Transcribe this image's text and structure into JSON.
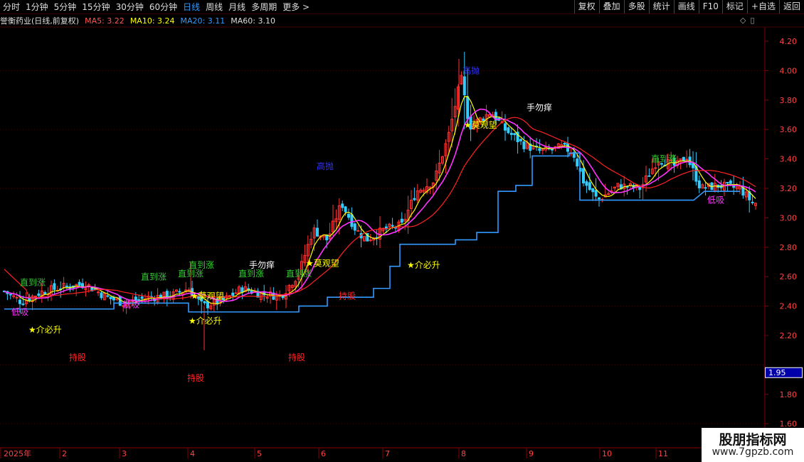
{
  "toolbar": {
    "periods": [
      "分时",
      "1分钟",
      "5分钟",
      "15分钟",
      "30分钟",
      "60分钟",
      "日线",
      "周线",
      "月线",
      "多周期",
      "更多 >"
    ],
    "active_period": "日线",
    "actions": [
      "复权",
      "叠加",
      "多股",
      "统计",
      "画线",
      "F10",
      "标记",
      "+自选",
      "返回"
    ]
  },
  "info": {
    "stock": "誉衡药业(日线,前复权)",
    "ma5": "MA5: 3.22",
    "ma10": "MA10: 3.24",
    "ma20": "MA20: 3.11",
    "ma60": "MA60: 3.10"
  },
  "controls": {
    "diamond": "◇",
    "panel": "▯"
  },
  "price_axis": {
    "ticks": [
      "4.20",
      "4.00",
      "3.80",
      "3.60",
      "3.40",
      "3.20",
      "3.00",
      "2.80",
      "2.60",
      "2.40",
      "2.20",
      "1.80",
      "1.60"
    ],
    "current_label": "1.95"
  },
  "x_axis": {
    "ticks": [
      "2025年",
      "2",
      "3",
      "4",
      "5",
      "6",
      "7",
      "8",
      "9",
      "10",
      "11"
    ]
  },
  "chart_labels": [
    {
      "text": "高抛",
      "color": "#33f",
      "kind": "sell"
    },
    {
      "text": "高抛",
      "color": "#33f",
      "kind": "sell"
    },
    {
      "text": "手勿痒",
      "color": "#fff",
      "kind": "warn"
    },
    {
      "text": "手勿痒",
      "color": "#fff",
      "kind": "warn"
    },
    {
      "text": "★莫观望",
      "color": "#ff0",
      "kind": "watch"
    },
    {
      "text": "★莫观望",
      "color": "#ff0",
      "kind": "watch"
    },
    {
      "text": "★莫观望",
      "color": "#ff0",
      "kind": "watch"
    },
    {
      "text": "★介必升",
      "color": "#ff0",
      "kind": "buy"
    },
    {
      "text": "★介必升",
      "color": "#ff0",
      "kind": "buy"
    },
    {
      "text": "★介必升",
      "color": "#ff0",
      "kind": "buy"
    },
    {
      "text": "低吸",
      "color": "#f3f",
      "kind": "low"
    },
    {
      "text": "低吸",
      "color": "#f3f",
      "kind": "low"
    },
    {
      "text": "低吸",
      "color": "#f3f",
      "kind": "low"
    },
    {
      "text": "直到涨",
      "color": "#3c3",
      "kind": "up"
    },
    {
      "text": "直到涨",
      "color": "#3c3",
      "kind": "up"
    },
    {
      "text": "直到涨",
      "color": "#3c3",
      "kind": "up"
    },
    {
      "text": "直到涨",
      "color": "#3c3",
      "kind": "up"
    },
    {
      "text": "直到涨",
      "color": "#3c3",
      "kind": "up"
    },
    {
      "text": "直到涨",
      "color": "#3c3",
      "kind": "up"
    },
    {
      "text": "直到涨",
      "color": "#3c3",
      "kind": "up"
    },
    {
      "text": "持股",
      "color": "#f22",
      "kind": "hold"
    },
    {
      "text": "持股",
      "color": "#f22",
      "kind": "hold"
    },
    {
      "text": "持股",
      "color": "#f22",
      "kind": "hold"
    },
    {
      "text": "持股",
      "color": "#f22",
      "kind": "hold"
    }
  ],
  "watermark": {
    "line1": "股朋指标网",
    "line2": "www.7gpzb.com"
  },
  "colors": {
    "up": "#f33",
    "down": "#3cf",
    "ma_red": "#f22",
    "ma_magenta": "#f3f",
    "ma_yellow": "#ff0",
    "support": "#39f",
    "grid": "#400"
  }
}
